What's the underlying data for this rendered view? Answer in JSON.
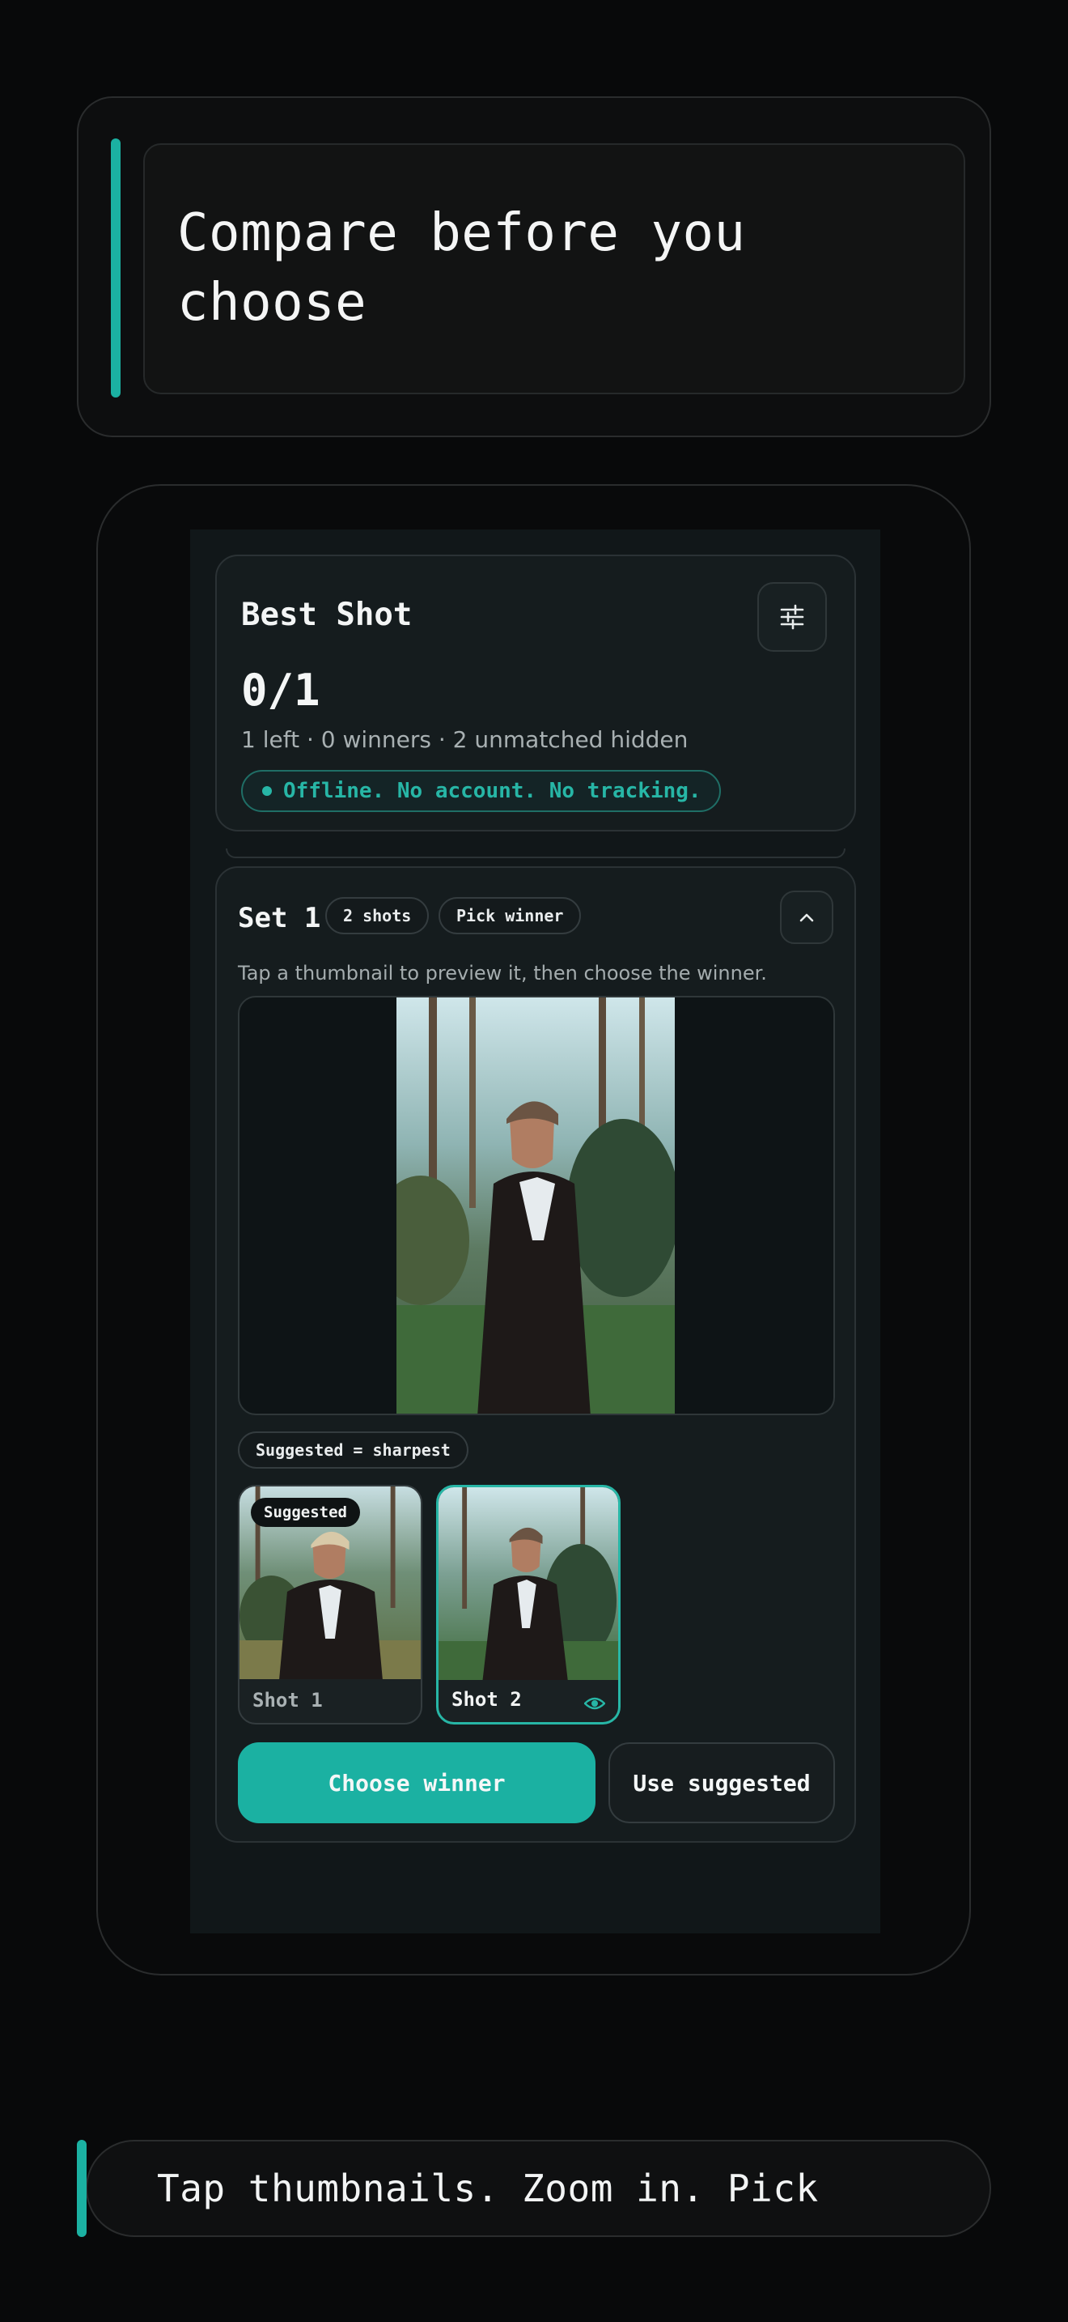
{
  "hero": {
    "title_line1": "Compare before you",
    "title_line2": "choose"
  },
  "app": {
    "title": "Best Shot",
    "progress": "0/1",
    "summary": "1 left · 0 winners · 2 unmatched hidden",
    "privacy": "Offline. No account. No tracking.",
    "filter_icon": "sliders-icon"
  },
  "set": {
    "title": "Set 1",
    "shots_chip": "2 shots",
    "mode_chip": "Pick winner",
    "collapse_icon": "chevron-up-icon",
    "hint": "Tap a thumbnail to preview it, then choose the winner.",
    "suggestion_rule": "Suggested = sharpest",
    "thumbnails": [
      {
        "label": "Shot 1",
        "badge": "Suggested",
        "selected": false
      },
      {
        "label": "Shot 2",
        "badge": "",
        "selected": true,
        "icon": "eye-icon"
      }
    ],
    "primary_action": "Choose winner",
    "secondary_action": "Use suggested"
  },
  "banner": {
    "text": "Tap thumbnails. Zoom in. Pick"
  },
  "colors": {
    "accent": "#1bb1a2",
    "background": "#08090a",
    "card": "#151c1e"
  }
}
